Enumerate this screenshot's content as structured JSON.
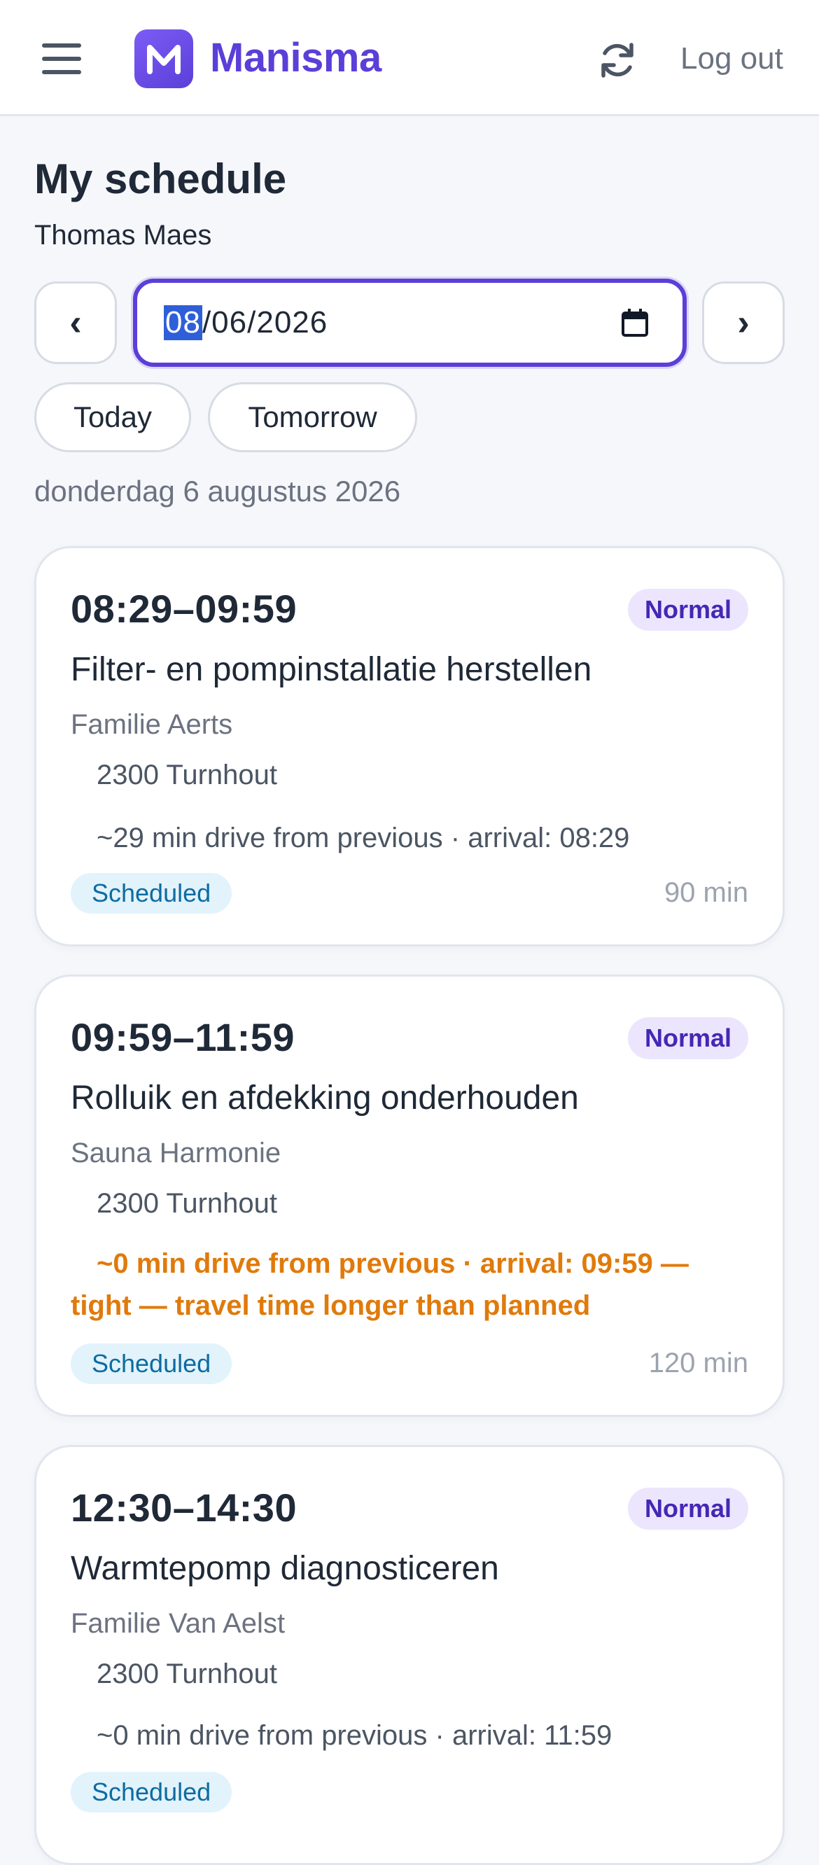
{
  "header": {
    "brand_name": "Manisma",
    "logout_label": "Log out"
  },
  "page": {
    "title": "My schedule",
    "user_name": "Thomas Maes"
  },
  "date_nav": {
    "prev_label": "‹",
    "next_label": "›",
    "date_value_day": "08",
    "date_value_rest": "/06/2026",
    "today_label": "Today",
    "tomorrow_label": "Tomorrow",
    "long_date": "donderdag 6 augustus 2026"
  },
  "appointments": [
    {
      "time": "08:29–09:59",
      "priority": "Normal",
      "title": "Filter- en pompinstallatie herstellen",
      "client": "Familie Aerts",
      "address": "2300 Turnhout",
      "drive": "~29 min drive from previous · arrival: 08:29",
      "status": "Scheduled",
      "duration": "90 min"
    },
    {
      "time": "09:59–11:59",
      "priority": "Normal",
      "title": "Rolluik en afdekking onderhouden",
      "client": "Sauna Harmonie",
      "address": "2300 Turnhout",
      "drive": "~0 min drive from previous · arrival: 09:59 — tight — travel time longer than planned",
      "status": "Scheduled",
      "duration": "120 min"
    },
    {
      "time": "12:30–14:30",
      "priority": "Normal",
      "title": "Warmtepomp diagnosticeren",
      "client": "Familie Van Aelst",
      "address": "2300 Turnhout",
      "drive": "~0 min drive from previous · arrival: 11:59",
      "status": "Scheduled",
      "duration": ""
    }
  ]
}
